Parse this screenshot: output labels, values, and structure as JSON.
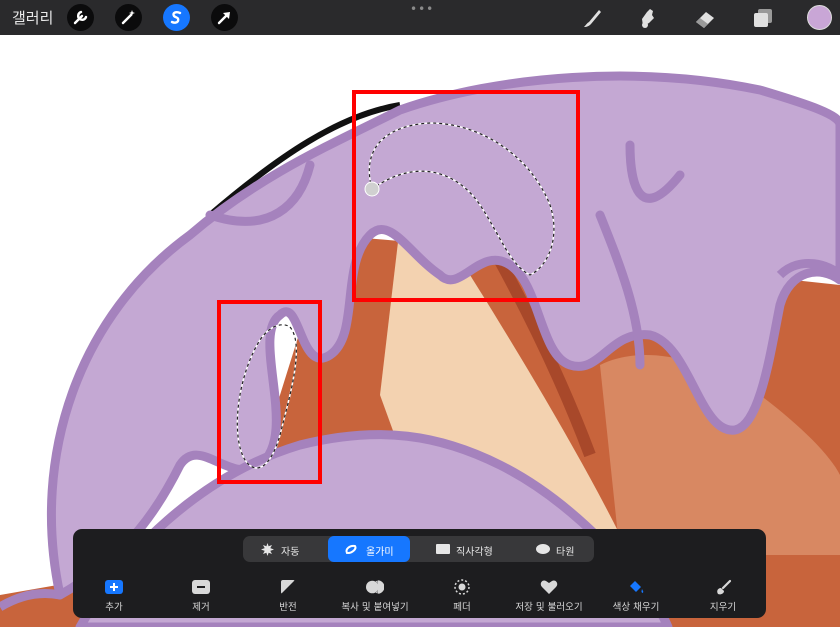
{
  "toolbar": {
    "gallery_label": "갤러리",
    "left_tools": [
      "wrench-icon",
      "magic-wand-icon",
      "selection-icon",
      "transform-arrow-icon"
    ],
    "active_tool": "selection-icon",
    "grab_handle": "•••",
    "right_tools": [
      "brush-icon",
      "smudge-icon",
      "eraser-icon",
      "layers-icon"
    ],
    "current_color": "#c9a6d6"
  },
  "selection_panel": {
    "modes": [
      {
        "label": "자동",
        "icon": "auto-icon"
      },
      {
        "label": "올가미",
        "icon": "lasso-icon"
      },
      {
        "label": "직사각형",
        "icon": "rectangle-icon"
      },
      {
        "label": "타원",
        "icon": "ellipse-icon"
      }
    ],
    "active_mode": "올가미",
    "actions": [
      {
        "label": "추가",
        "icon": "add-icon"
      },
      {
        "label": "제거",
        "icon": "remove-icon"
      },
      {
        "label": "반전",
        "icon": "invert-icon"
      },
      {
        "label": "복사 및 붙여넣기",
        "icon": "copy-paste-icon"
      },
      {
        "label": "페더",
        "icon": "feather-icon"
      },
      {
        "label": "저장 및 불러오기",
        "icon": "heart-icon"
      },
      {
        "label": "색상 채우기",
        "icon": "color-fill-icon"
      },
      {
        "label": "지우기",
        "icon": "clear-icon"
      }
    ]
  },
  "colors": {
    "accent": "#1677ff",
    "toolbar_bg": "#2a2a2c",
    "panel_bg": "#1d1d1f",
    "purple_fill": "#c4a8d3",
    "purple_outline": "#a582bd",
    "brown": "#c8643c",
    "dark_brown": "#a8482a",
    "peach": "#f3d2b0",
    "annotation_red": "#ff0000"
  }
}
